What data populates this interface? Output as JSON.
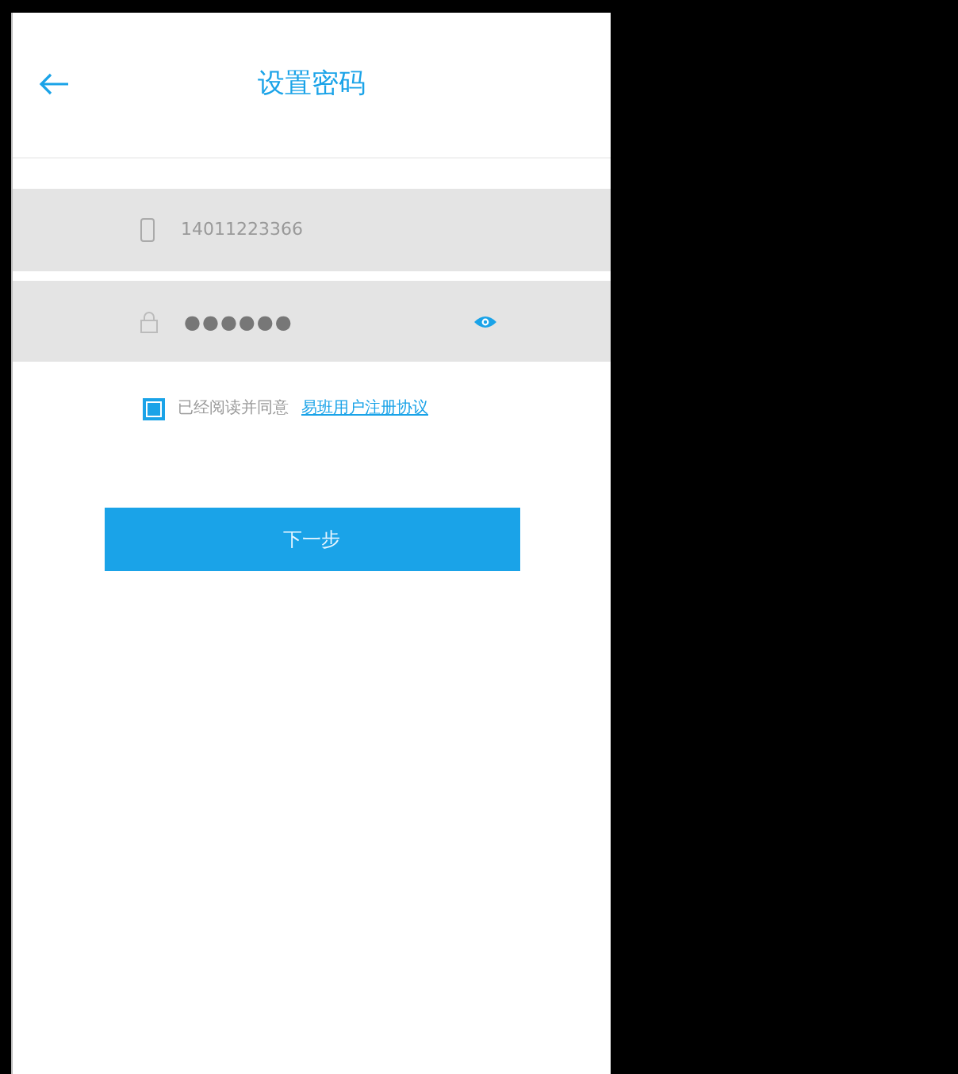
{
  "header": {
    "title": "设置密码"
  },
  "phone_field": {
    "value": "14011223366"
  },
  "password_field": {
    "value": "●●●●●●"
  },
  "agreement": {
    "checked": true,
    "text": "已经阅读并同意",
    "link": "易班用户注册协议"
  },
  "next_button": {
    "label": "下一步"
  }
}
